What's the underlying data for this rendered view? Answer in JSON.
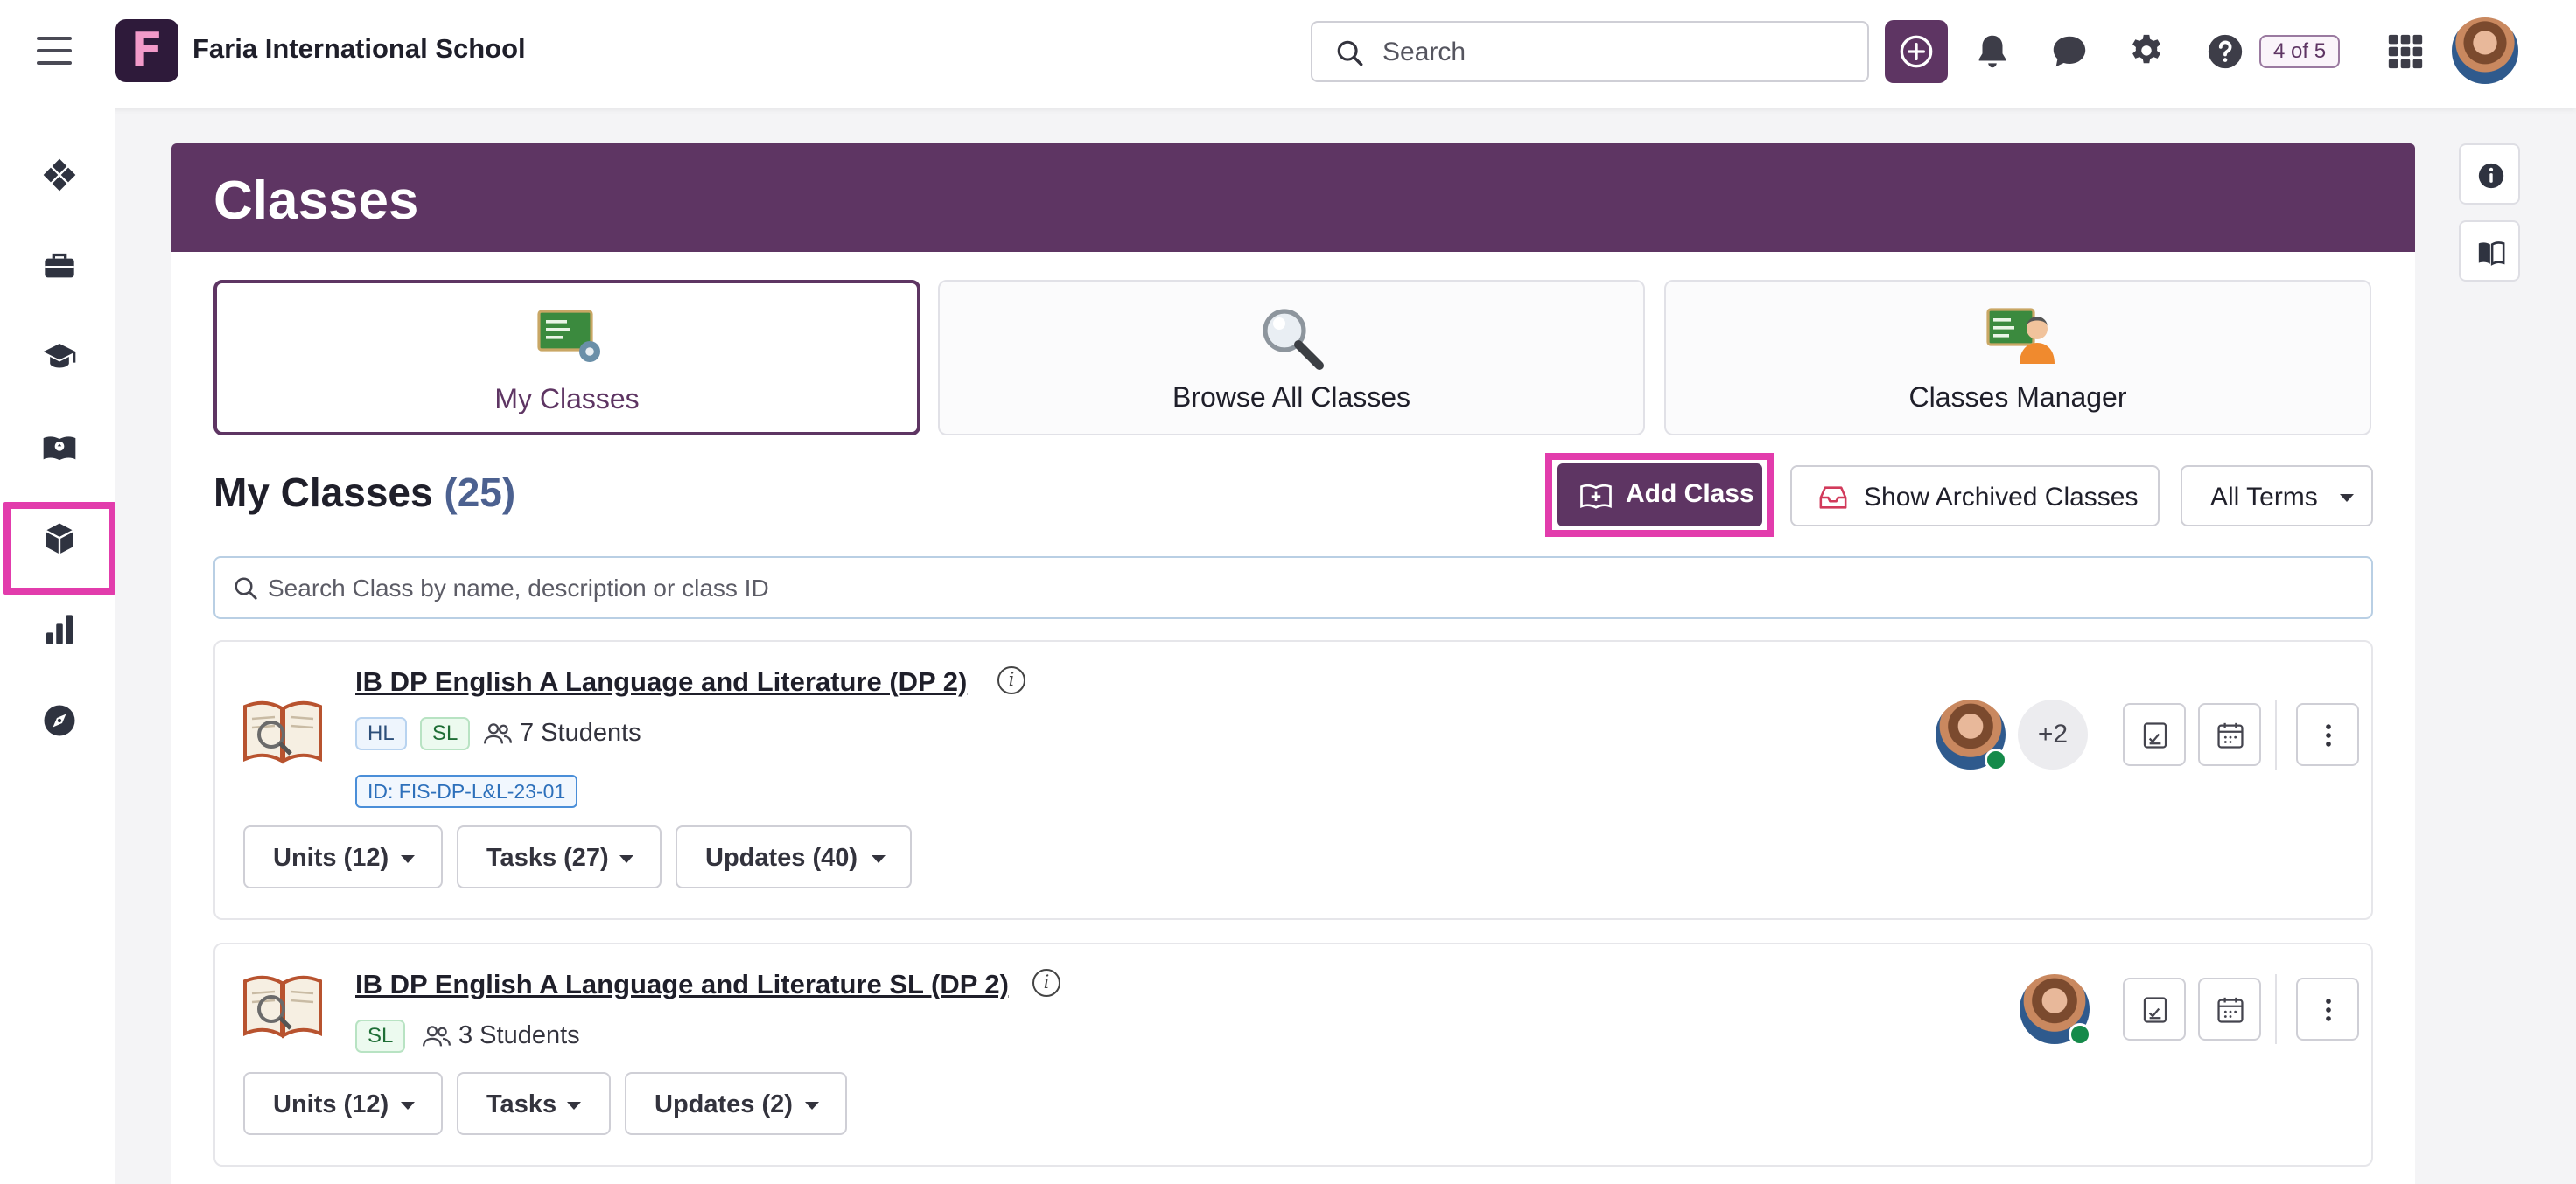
{
  "topbar": {
    "school_name": "Faria International School",
    "logo_letter": "F",
    "search_placeholder": "Search",
    "progress_badge": "4 of 5"
  },
  "page": {
    "title": "Classes"
  },
  "tabs": [
    {
      "label": "My Classes",
      "active": true
    },
    {
      "label": "Browse All Classes",
      "active": false
    },
    {
      "label": "Classes Manager",
      "active": false
    }
  ],
  "section": {
    "title": "My Classes",
    "count": "(25)",
    "add_class_label": "Add Class",
    "archived_label": "Show Archived Classes",
    "terms_label": "All Terms",
    "search_placeholder": "Search Class by name, description or class ID"
  },
  "classes": [
    {
      "name": "IB DP English A Language and Literature (DP 2)",
      "levels": [
        "HL",
        "SL"
      ],
      "students": "7 Students",
      "class_id": "ID: FIS-DP-L&L-23-01",
      "units": "Units (12)",
      "tasks": "Tasks (27)",
      "updates": "Updates (40)",
      "extra_teachers": "+2"
    },
    {
      "name": "IB DP English A Language and Literature SL (DP 2)",
      "levels": [
        "SL"
      ],
      "students": "3 Students",
      "units": "Units (12)",
      "tasks": "Tasks",
      "updates": "Updates (2)"
    }
  ],
  "colors": {
    "brand": "#5e3563",
    "highlight": "#e23cac",
    "online": "#158a4a"
  }
}
